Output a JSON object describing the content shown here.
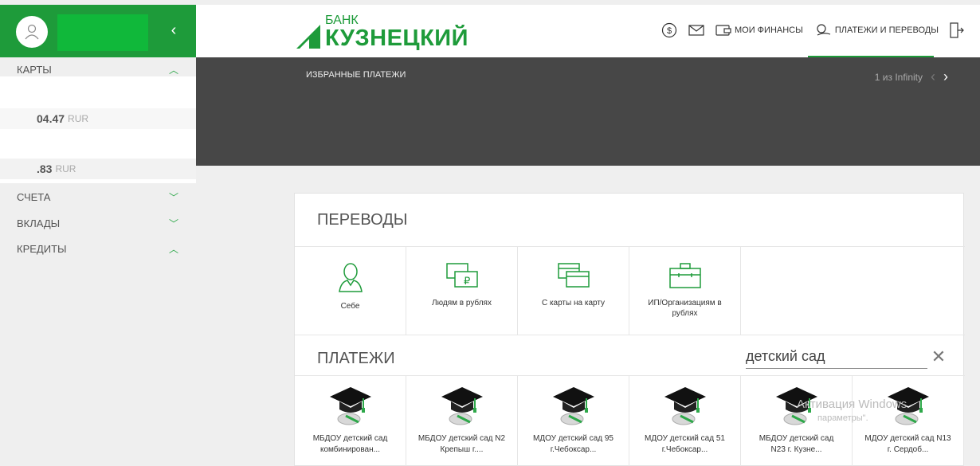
{
  "sidebar": {
    "sections": {
      "cards": "КАРТЫ",
      "accounts": "СЧЕТА",
      "deposits": "ВКЛАДЫ",
      "loans": "КРЕДИТЫ"
    },
    "card_rows": [
      {
        "amount": "04.47",
        "currency": "RUR"
      },
      {
        "amount": ".83",
        "currency": "RUR"
      }
    ]
  },
  "header": {
    "logo_line1": "БАНК",
    "logo_line2": "КУЗНЕЦКИЙ",
    "my_finances": "МОИ ФИНАНСЫ",
    "payments": "ПЛАТЕЖИ И ПЕРЕВОДЫ"
  },
  "band": {
    "title": "ИЗБРАННЫЕ ПЛАТЕЖИ",
    "pager": "1 из Infinity"
  },
  "transfers": {
    "title": "ПЕРЕВОДЫ",
    "tiles": [
      {
        "label": "Себе",
        "icon": "person-icon"
      },
      {
        "label": "Людям в рублях",
        "icon": "ruble-cards-icon"
      },
      {
        "label": "С карты на карту",
        "icon": "cards-icon"
      },
      {
        "label": "ИП/Организациям в рублях",
        "icon": "briefcase-icon"
      }
    ]
  },
  "payments": {
    "title": "ПЛАТЕЖИ",
    "search_value": "детский сад",
    "results": [
      {
        "line1": "МБДОУ детский сад",
        "line2": "комбинирован..."
      },
      {
        "line1": "МБДОУ детский сад N2",
        "line2": "Крепыш г...."
      },
      {
        "line1": "МДОУ детский сад 95",
        "line2": "г.Чебоксар..."
      },
      {
        "line1": "МДОУ детский сад 51",
        "line2": "г.Чебоксар..."
      },
      {
        "line1": "МБДОУ детский сад",
        "line2": "N23 г. Кузне..."
      },
      {
        "line1": "МДОУ детский сад N13",
        "line2": "г. Сердоб..."
      }
    ]
  },
  "watermark": {
    "line1": "Активация Windows",
    "line2": "параметры\"."
  },
  "colors": {
    "brand": "#1e9b3a",
    "band": "#474747"
  }
}
